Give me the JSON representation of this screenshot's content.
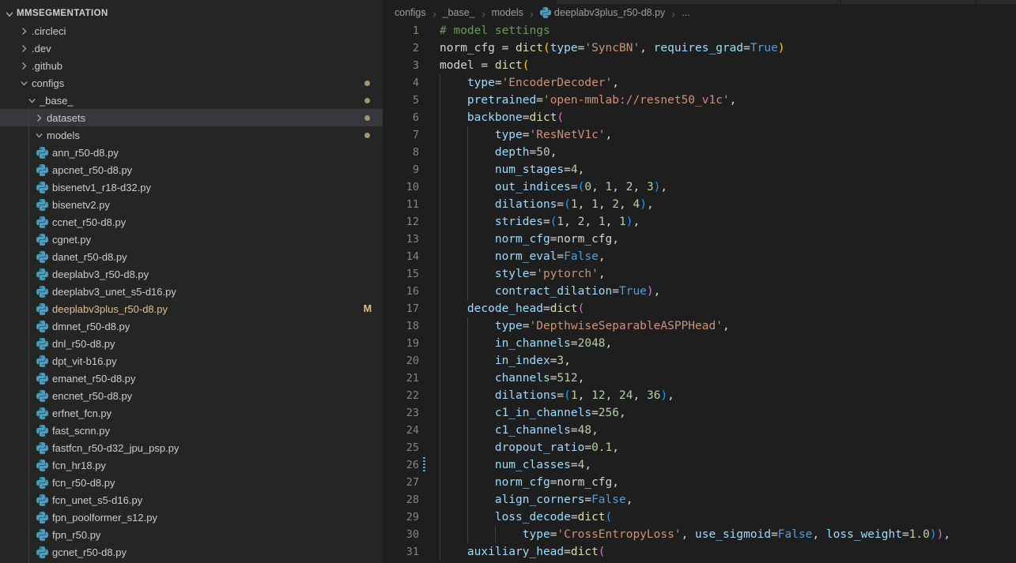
{
  "colors": {
    "bg-editor": "#1e1e1e",
    "bg-sidebar": "#252526",
    "bg-selected": "#37373d",
    "fg-tree": "#cccccc",
    "fg-linenum": "#858585",
    "fg-breadcrumb": "#9d9d9d",
    "fg-bc-sep": "#6e6e6e",
    "tok-c": "#6A9955",
    "tok-v": "#d4d4d4",
    "tok-f": "#DCDCAA",
    "tok-p": "#9CDCFE",
    "tok-s": "#CE9178",
    "tok-n": "#B5CEA8",
    "tok-k": "#569CD6",
    "tok-b1": "#FFD700",
    "tok-b2": "#DA70D6",
    "tok-b3": "#179FFF",
    "git-modified": "#E2C08D",
    "folder-dot": "#a79572",
    "py-icon": "#519aba",
    "guide": "#404040",
    "mod-marker": "#3da8d8"
  },
  "explorer": {
    "root": "MMSEGMENTATION",
    "items": [
      {
        "label": ".circleci",
        "type": "folder",
        "level": 1,
        "expanded": false
      },
      {
        "label": ".dev",
        "type": "folder",
        "level": 1,
        "expanded": false
      },
      {
        "label": ".github",
        "type": "folder",
        "level": 1,
        "expanded": false
      },
      {
        "label": "configs",
        "type": "folder",
        "level": 1,
        "expanded": true,
        "dot": true
      },
      {
        "label": "_base_",
        "type": "folder",
        "level": 2,
        "expanded": true,
        "dot": true
      },
      {
        "label": "datasets",
        "type": "folder",
        "level": 3,
        "expanded": false,
        "dot": true,
        "selected": true
      },
      {
        "label": "models",
        "type": "folder",
        "level": 3,
        "expanded": true,
        "dot": true
      },
      {
        "label": "ann_r50-d8.py",
        "type": "file",
        "level": 4
      },
      {
        "label": "apcnet_r50-d8.py",
        "type": "file",
        "level": 4
      },
      {
        "label": "bisenetv1_r18-d32.py",
        "type": "file",
        "level": 4
      },
      {
        "label": "bisenetv2.py",
        "type": "file",
        "level": 4
      },
      {
        "label": "ccnet_r50-d8.py",
        "type": "file",
        "level": 4
      },
      {
        "label": "cgnet.py",
        "type": "file",
        "level": 4
      },
      {
        "label": "danet_r50-d8.py",
        "type": "file",
        "level": 4
      },
      {
        "label": "deeplabv3_r50-d8.py",
        "type": "file",
        "level": 4
      },
      {
        "label": "deeplabv3_unet_s5-d16.py",
        "type": "file",
        "level": 4
      },
      {
        "label": "deeplabv3plus_r50-d8.py",
        "type": "file",
        "level": 4,
        "modified": true,
        "badge": "M"
      },
      {
        "label": "dmnet_r50-d8.py",
        "type": "file",
        "level": 4
      },
      {
        "label": "dnl_r50-d8.py",
        "type": "file",
        "level": 4
      },
      {
        "label": "dpt_vit-b16.py",
        "type": "file",
        "level": 4
      },
      {
        "label": "emanet_r50-d8.py",
        "type": "file",
        "level": 4
      },
      {
        "label": "encnet_r50-d8.py",
        "type": "file",
        "level": 4
      },
      {
        "label": "erfnet_fcn.py",
        "type": "file",
        "level": 4
      },
      {
        "label": "fast_scnn.py",
        "type": "file",
        "level": 4
      },
      {
        "label": "fastfcn_r50-d32_jpu_psp.py",
        "type": "file",
        "level": 4
      },
      {
        "label": "fcn_hr18.py",
        "type": "file",
        "level": 4
      },
      {
        "label": "fcn_r50-d8.py",
        "type": "file",
        "level": 4
      },
      {
        "label": "fcn_unet_s5-d16.py",
        "type": "file",
        "level": 4
      },
      {
        "label": "fpn_poolformer_s12.py",
        "type": "file",
        "level": 4
      },
      {
        "label": "fpn_r50.py",
        "type": "file",
        "level": 4
      },
      {
        "label": "gcnet_r50-d8.py",
        "type": "file",
        "level": 4
      }
    ]
  },
  "breadcrumb": {
    "items": [
      "configs",
      "_base_",
      "models"
    ],
    "file": "deeplabv3plus_r50-d8.py",
    "overflow": "..."
  },
  "editor": {
    "lines": [
      {
        "n": 1,
        "indent": 0,
        "tokens": [
          [
            "c",
            "# model settings"
          ]
        ]
      },
      {
        "n": 2,
        "indent": 0,
        "tokens": [
          [
            "v",
            "norm_cfg = "
          ],
          [
            "f",
            "dict"
          ],
          [
            "b1",
            "("
          ],
          [
            "p",
            "type"
          ],
          [
            "v",
            "="
          ],
          [
            "s",
            "'SyncBN'"
          ],
          [
            "v",
            ", "
          ],
          [
            "p",
            "requires_grad"
          ],
          [
            "v",
            "="
          ],
          [
            "k",
            "True"
          ],
          [
            "b1",
            ")"
          ]
        ]
      },
      {
        "n": 3,
        "indent": 0,
        "tokens": [
          [
            "v",
            "model = "
          ],
          [
            "f",
            "dict"
          ],
          [
            "b1",
            "("
          ]
        ]
      },
      {
        "n": 4,
        "indent": 4,
        "tokens": [
          [
            "v",
            "    "
          ],
          [
            "p",
            "type"
          ],
          [
            "v",
            "="
          ],
          [
            "s",
            "'EncoderDecoder'"
          ],
          [
            "v",
            ","
          ]
        ]
      },
      {
        "n": 5,
        "indent": 4,
        "tokens": [
          [
            "v",
            "    "
          ],
          [
            "p",
            "pretrained"
          ],
          [
            "v",
            "="
          ],
          [
            "s",
            "'open-mmlab://resnet50_v1c'"
          ],
          [
            "v",
            ","
          ]
        ]
      },
      {
        "n": 6,
        "indent": 4,
        "tokens": [
          [
            "v",
            "    "
          ],
          [
            "p",
            "backbone"
          ],
          [
            "v",
            "="
          ],
          [
            "f",
            "dict"
          ],
          [
            "b2",
            "("
          ]
        ]
      },
      {
        "n": 7,
        "indent": 8,
        "tokens": [
          [
            "v",
            "        "
          ],
          [
            "p",
            "type"
          ],
          [
            "v",
            "="
          ],
          [
            "s",
            "'ResNetV1c'"
          ],
          [
            "v",
            ","
          ]
        ]
      },
      {
        "n": 8,
        "indent": 8,
        "tokens": [
          [
            "v",
            "        "
          ],
          [
            "p",
            "depth"
          ],
          [
            "v",
            "="
          ],
          [
            "n",
            "50"
          ],
          [
            "v",
            ","
          ]
        ]
      },
      {
        "n": 9,
        "indent": 8,
        "tokens": [
          [
            "v",
            "        "
          ],
          [
            "p",
            "num_stages"
          ],
          [
            "v",
            "="
          ],
          [
            "n",
            "4"
          ],
          [
            "v",
            ","
          ]
        ]
      },
      {
        "n": 10,
        "indent": 8,
        "tokens": [
          [
            "v",
            "        "
          ],
          [
            "p",
            "out_indices"
          ],
          [
            "v",
            "="
          ],
          [
            "b3",
            "("
          ],
          [
            "n",
            "0"
          ],
          [
            "v",
            ", "
          ],
          [
            "n",
            "1"
          ],
          [
            "v",
            ", "
          ],
          [
            "n",
            "2"
          ],
          [
            "v",
            ", "
          ],
          [
            "n",
            "3"
          ],
          [
            "b3",
            ")"
          ],
          [
            "v",
            ","
          ]
        ]
      },
      {
        "n": 11,
        "indent": 8,
        "tokens": [
          [
            "v",
            "        "
          ],
          [
            "p",
            "dilations"
          ],
          [
            "v",
            "="
          ],
          [
            "b3",
            "("
          ],
          [
            "n",
            "1"
          ],
          [
            "v",
            ", "
          ],
          [
            "n",
            "1"
          ],
          [
            "v",
            ", "
          ],
          [
            "n",
            "2"
          ],
          [
            "v",
            ", "
          ],
          [
            "n",
            "4"
          ],
          [
            "b3",
            ")"
          ],
          [
            "v",
            ","
          ]
        ]
      },
      {
        "n": 12,
        "indent": 8,
        "tokens": [
          [
            "v",
            "        "
          ],
          [
            "p",
            "strides"
          ],
          [
            "v",
            "="
          ],
          [
            "b3",
            "("
          ],
          [
            "n",
            "1"
          ],
          [
            "v",
            ", "
          ],
          [
            "n",
            "2"
          ],
          [
            "v",
            ", "
          ],
          [
            "n",
            "1"
          ],
          [
            "v",
            ", "
          ],
          [
            "n",
            "1"
          ],
          [
            "b3",
            ")"
          ],
          [
            "v",
            ","
          ]
        ]
      },
      {
        "n": 13,
        "indent": 8,
        "tokens": [
          [
            "v",
            "        "
          ],
          [
            "p",
            "norm_cfg"
          ],
          [
            "v",
            "="
          ],
          [
            "v",
            "norm_cfg"
          ],
          [
            "v",
            ","
          ]
        ]
      },
      {
        "n": 14,
        "indent": 8,
        "tokens": [
          [
            "v",
            "        "
          ],
          [
            "p",
            "norm_eval"
          ],
          [
            "v",
            "="
          ],
          [
            "k",
            "False"
          ],
          [
            "v",
            ","
          ]
        ]
      },
      {
        "n": 15,
        "indent": 8,
        "tokens": [
          [
            "v",
            "        "
          ],
          [
            "p",
            "style"
          ],
          [
            "v",
            "="
          ],
          [
            "s",
            "'pytorch'"
          ],
          [
            "v",
            ","
          ]
        ]
      },
      {
        "n": 16,
        "indent": 8,
        "tokens": [
          [
            "v",
            "        "
          ],
          [
            "p",
            "contract_dilation"
          ],
          [
            "v",
            "="
          ],
          [
            "k",
            "True"
          ],
          [
            "b2",
            ")"
          ],
          [
            "v",
            ","
          ]
        ]
      },
      {
        "n": 17,
        "indent": 4,
        "tokens": [
          [
            "v",
            "    "
          ],
          [
            "p",
            "decode_head"
          ],
          [
            "v",
            "="
          ],
          [
            "f",
            "dict"
          ],
          [
            "b2",
            "("
          ]
        ]
      },
      {
        "n": 18,
        "indent": 8,
        "tokens": [
          [
            "v",
            "        "
          ],
          [
            "p",
            "type"
          ],
          [
            "v",
            "="
          ],
          [
            "s",
            "'DepthwiseSeparableASPPHead'"
          ],
          [
            "v",
            ","
          ]
        ]
      },
      {
        "n": 19,
        "indent": 8,
        "tokens": [
          [
            "v",
            "        "
          ],
          [
            "p",
            "in_channels"
          ],
          [
            "v",
            "="
          ],
          [
            "n",
            "2048"
          ],
          [
            "v",
            ","
          ]
        ]
      },
      {
        "n": 20,
        "indent": 8,
        "tokens": [
          [
            "v",
            "        "
          ],
          [
            "p",
            "in_index"
          ],
          [
            "v",
            "="
          ],
          [
            "n",
            "3"
          ],
          [
            "v",
            ","
          ]
        ]
      },
      {
        "n": 21,
        "indent": 8,
        "tokens": [
          [
            "v",
            "        "
          ],
          [
            "p",
            "channels"
          ],
          [
            "v",
            "="
          ],
          [
            "n",
            "512"
          ],
          [
            "v",
            ","
          ]
        ]
      },
      {
        "n": 22,
        "indent": 8,
        "tokens": [
          [
            "v",
            "        "
          ],
          [
            "p",
            "dilations"
          ],
          [
            "v",
            "="
          ],
          [
            "b3",
            "("
          ],
          [
            "n",
            "1"
          ],
          [
            "v",
            ", "
          ],
          [
            "n",
            "12"
          ],
          [
            "v",
            ", "
          ],
          [
            "n",
            "24"
          ],
          [
            "v",
            ", "
          ],
          [
            "n",
            "36"
          ],
          [
            "b3",
            ")"
          ],
          [
            "v",
            ","
          ]
        ]
      },
      {
        "n": 23,
        "indent": 8,
        "tokens": [
          [
            "v",
            "        "
          ],
          [
            "p",
            "c1_in_channels"
          ],
          [
            "v",
            "="
          ],
          [
            "n",
            "256"
          ],
          [
            "v",
            ","
          ]
        ]
      },
      {
        "n": 24,
        "indent": 8,
        "tokens": [
          [
            "v",
            "        "
          ],
          [
            "p",
            "c1_channels"
          ],
          [
            "v",
            "="
          ],
          [
            "n",
            "48"
          ],
          [
            "v",
            ","
          ]
        ]
      },
      {
        "n": 25,
        "indent": 8,
        "tokens": [
          [
            "v",
            "        "
          ],
          [
            "p",
            "dropout_ratio"
          ],
          [
            "v",
            "="
          ],
          [
            "n",
            "0.1"
          ],
          [
            "v",
            ","
          ]
        ]
      },
      {
        "n": 26,
        "indent": 8,
        "modified": true,
        "tokens": [
          [
            "v",
            "        "
          ],
          [
            "p",
            "num_classes"
          ],
          [
            "v",
            "="
          ],
          [
            "n",
            "4"
          ],
          [
            "v",
            ","
          ]
        ]
      },
      {
        "n": 27,
        "indent": 8,
        "tokens": [
          [
            "v",
            "        "
          ],
          [
            "p",
            "norm_cfg"
          ],
          [
            "v",
            "="
          ],
          [
            "v",
            "norm_cfg"
          ],
          [
            "v",
            ","
          ]
        ]
      },
      {
        "n": 28,
        "indent": 8,
        "tokens": [
          [
            "v",
            "        "
          ],
          [
            "p",
            "align_corners"
          ],
          [
            "v",
            "="
          ],
          [
            "k",
            "False"
          ],
          [
            "v",
            ","
          ]
        ]
      },
      {
        "n": 29,
        "indent": 8,
        "tokens": [
          [
            "v",
            "        "
          ],
          [
            "p",
            "loss_decode"
          ],
          [
            "v",
            "="
          ],
          [
            "f",
            "dict"
          ],
          [
            "b3",
            "("
          ]
        ]
      },
      {
        "n": 30,
        "indent": 12,
        "tokens": [
          [
            "v",
            "            "
          ],
          [
            "p",
            "type"
          ],
          [
            "v",
            "="
          ],
          [
            "s",
            "'CrossEntropyLoss'"
          ],
          [
            "v",
            ", "
          ],
          [
            "p",
            "use_sigmoid"
          ],
          [
            "v",
            "="
          ],
          [
            "k",
            "False"
          ],
          [
            "v",
            ", "
          ],
          [
            "p",
            "loss_weight"
          ],
          [
            "v",
            "="
          ],
          [
            "n",
            "1.0"
          ],
          [
            "b3",
            ")"
          ],
          [
            "b2",
            ")"
          ],
          [
            "v",
            ","
          ]
        ]
      },
      {
        "n": 31,
        "indent": 4,
        "tokens": [
          [
            "v",
            "    "
          ],
          [
            "p",
            "auxiliary_head"
          ],
          [
            "v",
            "="
          ],
          [
            "f",
            "dict"
          ],
          [
            "b2",
            "("
          ]
        ]
      }
    ]
  }
}
